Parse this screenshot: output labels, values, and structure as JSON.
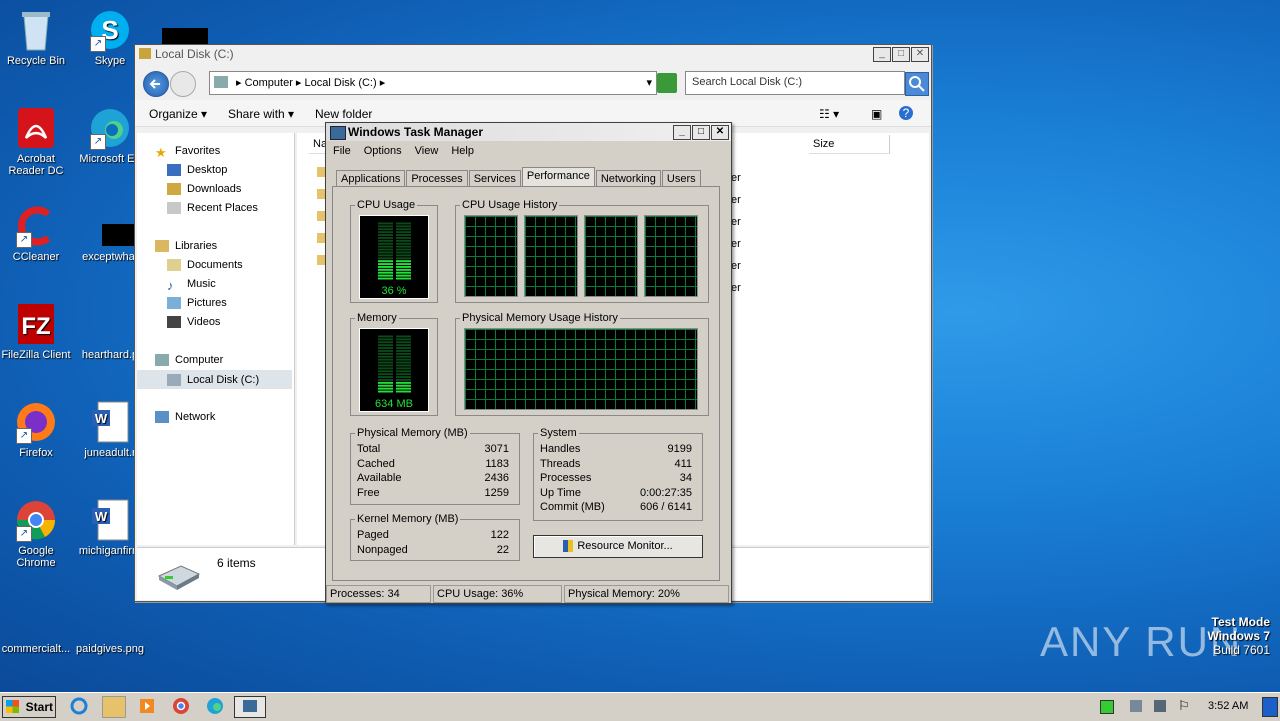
{
  "desktop": {
    "icons": [
      {
        "label": "Recycle Bin"
      },
      {
        "label": "Skype"
      },
      {
        "label": "Acrobat Reader DC"
      },
      {
        "label": "Microsoft Ed"
      },
      {
        "label": "CCleaner"
      },
      {
        "label": "exceptwhat"
      },
      {
        "label": "FileZilla Client"
      },
      {
        "label": "hearthard.p"
      },
      {
        "label": "Firefox"
      },
      {
        "label": "juneadult.r"
      },
      {
        "label": "Google Chrome"
      },
      {
        "label": "michiganfirm"
      },
      {
        "label": "commercialt..."
      },
      {
        "label": "paidgives.png"
      }
    ]
  },
  "explorer": {
    "title": "Local Disk (C:)",
    "breadcrumb": [
      "Computer",
      "Local Disk (C:)"
    ],
    "search_placeholder": "Search Local Disk (C:)",
    "toolbar": {
      "organize": "Organize",
      "share": "Share with",
      "new_folder": "New folder"
    },
    "nav": {
      "favorites": "Favorites",
      "desktop": "Desktop",
      "downloads": "Downloads",
      "recent": "Recent Places",
      "libraries": "Libraries",
      "documents": "Documents",
      "music": "Music",
      "pictures": "Pictures",
      "videos": "Videos",
      "computer": "Computer",
      "local_disk": "Local Disk (C:)",
      "network": "Network"
    },
    "columns": {
      "name": "Na",
      "size": "Size"
    },
    "row_suffix": "er",
    "status": "6 items"
  },
  "taskmgr": {
    "title": "Windows Task Manager",
    "menu": [
      "File",
      "Options",
      "View",
      "Help"
    ],
    "tabs": [
      "Applications",
      "Processes",
      "Services",
      "Performance",
      "Networking",
      "Users"
    ],
    "active_tab": "Performance",
    "cpu_usage_label": "CPU Usage",
    "cpu_usage_value": "36 %",
    "cpu_fraction": 0.36,
    "cpu_history_label": "CPU Usage History",
    "memory_label": "Memory",
    "memory_value": "634 MB",
    "memory_fraction": 0.2,
    "phys_history_label": "Physical Memory Usage History",
    "physical": {
      "label": "Physical Memory (MB)",
      "rows": [
        {
          "k": "Total",
          "v": "3071"
        },
        {
          "k": "Cached",
          "v": "1183"
        },
        {
          "k": "Available",
          "v": "2436"
        },
        {
          "k": "Free",
          "v": "1259"
        }
      ]
    },
    "kernel": {
      "label": "Kernel Memory (MB)",
      "rows": [
        {
          "k": "Paged",
          "v": "122"
        },
        {
          "k": "Nonpaged",
          "v": "22"
        }
      ]
    },
    "system": {
      "label": "System",
      "rows": [
        {
          "k": "Handles",
          "v": "9199"
        },
        {
          "k": "Threads",
          "v": "411"
        },
        {
          "k": "Processes",
          "v": "34"
        },
        {
          "k": "Up Time",
          "v": "0:00:27:35"
        },
        {
          "k": "Commit (MB)",
          "v": "606 / 6141"
        }
      ]
    },
    "resource_monitor": "Resource Monitor...",
    "status": {
      "processes": "Processes: 34",
      "cpu": "CPU Usage: 36%",
      "mem": "Physical Memory: 20%"
    }
  },
  "taskbar": {
    "start": "Start",
    "clock": "3:52 AM"
  },
  "watermark": {
    "line1": "Test Mode",
    "line2": "Windows 7",
    "line3": "Build 7601",
    "brand": "ANY RUN"
  },
  "colors": {
    "meter_green": "#22e03a",
    "grid_green": "#0a7a3a",
    "titlebar_active": "#dcdcdc"
  }
}
